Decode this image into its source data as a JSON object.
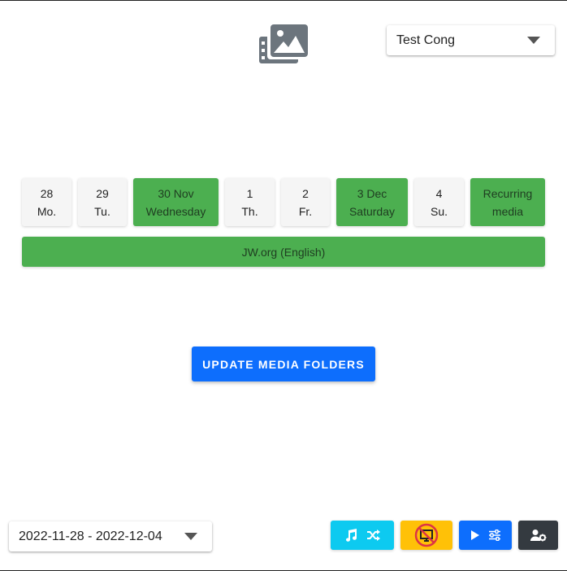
{
  "header": {
    "logo_icon": "media-gallery-icon",
    "congregation": "Test Cong"
  },
  "days": [
    {
      "line1": "28",
      "line2": "Mo.",
      "active": false
    },
    {
      "line1": "29",
      "line2": "Tu.",
      "active": false
    },
    {
      "line1": "30 Nov",
      "line2": "Wednesday",
      "active": true
    },
    {
      "line1": "1",
      "line2": "Th.",
      "active": false
    },
    {
      "line1": "2",
      "line2": "Fr.",
      "active": false
    },
    {
      "line1": "3 Dec",
      "line2": "Saturday",
      "active": true
    },
    {
      "line1": "4",
      "line2": "Su.",
      "active": false
    },
    {
      "line1": "Recurring",
      "line2": "media",
      "active": true
    }
  ],
  "source": {
    "label": "JW.org (English)"
  },
  "actions": {
    "update_label": "UPDATE MEDIA FOLDERS"
  },
  "footer": {
    "week_range": "2022-11-28 - 2022-12-04",
    "toolbar": [
      {
        "name": "music-shuffle",
        "icons": [
          "music-note-icon",
          "shuffle-icon"
        ],
        "color": "#0dcaf0"
      },
      {
        "name": "presentation-mode",
        "icons": [
          "no-presentation-icon"
        ],
        "color": "#ffc107"
      },
      {
        "name": "play-settings",
        "icons": [
          "play-icon",
          "sliders-icon"
        ],
        "color": "#0d6efd"
      },
      {
        "name": "user-settings",
        "icons": [
          "user-gear-icon"
        ],
        "color": "#343a40"
      }
    ]
  },
  "colors": {
    "active_day": "#4caf50",
    "primary": "#0d6efd"
  }
}
